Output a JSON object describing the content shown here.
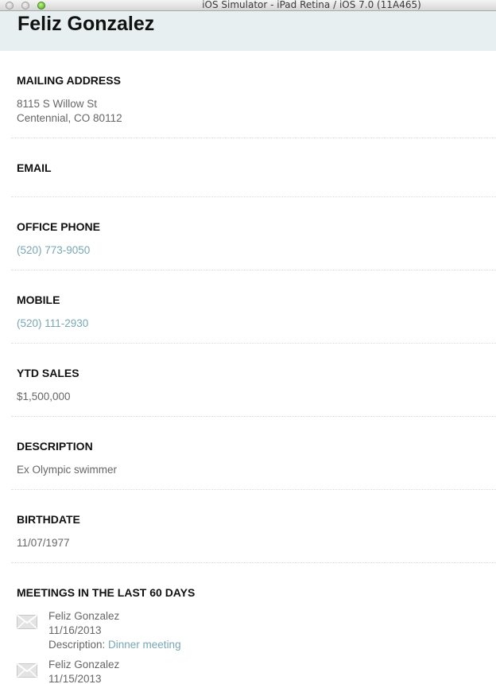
{
  "window": {
    "title": "iOS Simulator - iPad Retina / iOS 7.0 (11A465)"
  },
  "contact": {
    "name": "Feliz Gonzalez"
  },
  "fields": {
    "mailing_address": {
      "label": "MAILING ADDRESS",
      "line1": "8115 S Willow St",
      "line2": "Centennial, CO 80112"
    },
    "email": {
      "label": "EMAIL",
      "value": ""
    },
    "office_phone": {
      "label": "OFFICE PHONE",
      "value": "(520) 773-9050"
    },
    "mobile": {
      "label": "MOBILE",
      "value": "(520) 111-2930"
    },
    "ytd_sales": {
      "label": "YTD SALES",
      "value": "$1,500,000"
    },
    "description": {
      "label": "DESCRIPTION",
      "value": "Ex Olympic swimmer"
    },
    "birthdate": {
      "label": "BIRTHDATE",
      "value": "11/07/1977"
    }
  },
  "meetings": {
    "label": "MEETINGS IN THE LAST 60 DAYS",
    "items": [
      {
        "icon": "envelope-icon",
        "name": "Feliz Gonzalez",
        "date": "11/16/2013",
        "description_label": "Description: ",
        "description": "Dinner meeting"
      },
      {
        "icon": "envelope-icon",
        "name": "Feliz Gonzalez",
        "date": "11/15/2013"
      }
    ]
  },
  "colors": {
    "header_bg": "#e7eff0",
    "link": "#76a7b4",
    "text": "#666666"
  }
}
